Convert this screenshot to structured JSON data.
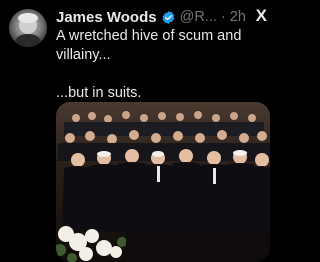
{
  "tweet": {
    "author_name": "James Woods",
    "handle_time": "@R... · 2h",
    "text_line1": "A wretched hive of scum and villainy...",
    "text_line2": "...but in suits.",
    "brand_logo": "X",
    "avatar_icon": "user-avatar",
    "verified_icon": "verified-badge-icon",
    "media_icon": "photo-of-people-seated-at-event"
  },
  "colors": {
    "background": "#000000",
    "text_primary": "#e7e9ea",
    "text_secondary": "#71767b",
    "verified_blue": "#1d9bf0"
  }
}
